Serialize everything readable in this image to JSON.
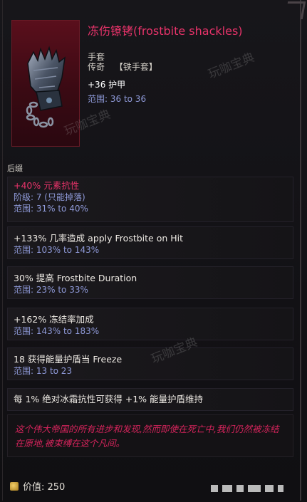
{
  "item": {
    "title": "冻伤镣铐(frostbite shackles)",
    "type": "手套",
    "rarity": "传奇",
    "base_type": "【铁手套】",
    "implicit": {
      "value": "+36 护甲",
      "range": "范围: 36 to 36"
    }
  },
  "suffix_label": "后缀",
  "affixes": [
    {
      "line1": "+40% 元素抗性",
      "line2": "阶级: 7 (只能掉落)",
      "range": "范围: 31% to 40%"
    },
    {
      "line1": "+133% 几率造成 apply Frostbite on Hit",
      "range": "范围: 103% to 143%"
    },
    {
      "line1": "30% 提高 Frostbite Duration",
      "range": "范围: 23% to 33%"
    },
    {
      "line1": "+162% 冻结率加成",
      "range": "范围: 143% to 183%"
    },
    {
      "line1": "18 获得能量护盾当 Freeze",
      "range": "范围: 13 to 23"
    },
    {
      "line1": "每 1% 绝对冰霜抗性可获得 +1% 能量护盾维持"
    }
  ],
  "lore": "这个伟大帝国的所有进步和发现,然而即使在死亡中,我们仍然被冻结在原地,被束缚在这个凡间。",
  "price": {
    "label": "价值: 250"
  },
  "watermarks": [
    "玩咖宝典",
    "玩咖宝典",
    "玩咖宝典"
  ],
  "colors": {
    "unique": "#e8336a",
    "range": "#8f9ad9",
    "panel": "#121115"
  },
  "icons": [
    "frostbite-shackles-item-icon",
    "coin-icon"
  ]
}
